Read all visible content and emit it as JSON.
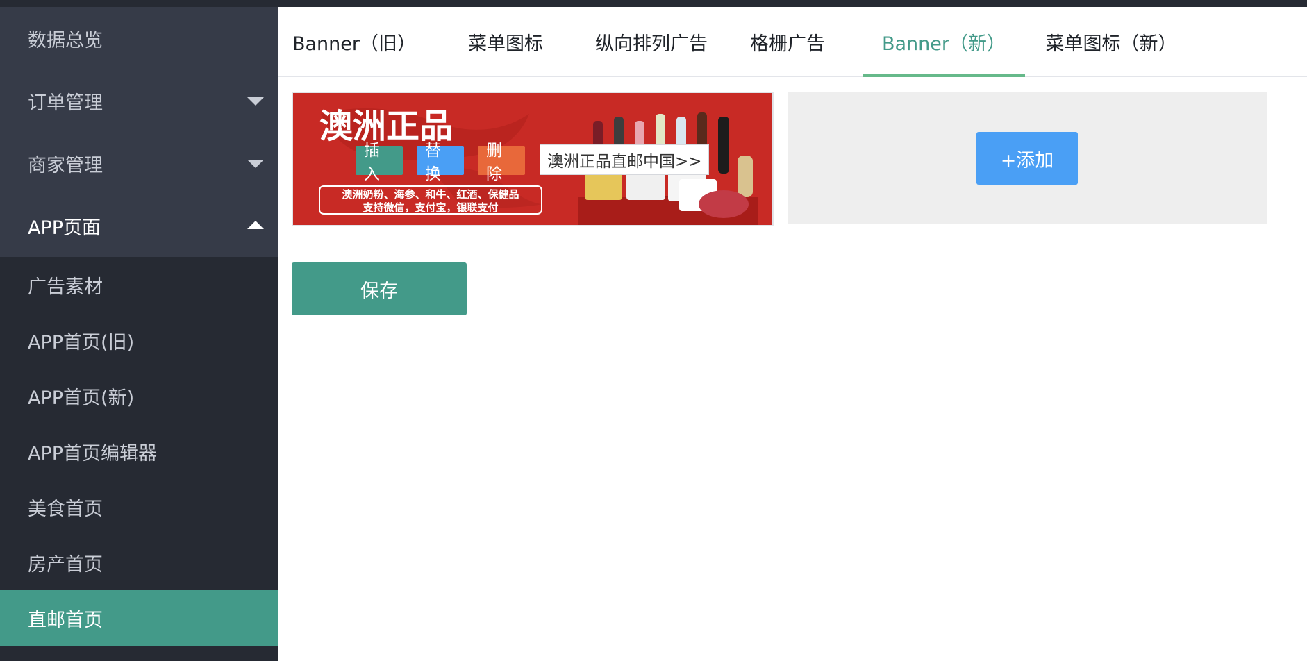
{
  "sidebar": {
    "top_items": [
      {
        "label": "数据总览",
        "arrow": "none"
      },
      {
        "label": "订单管理",
        "arrow": "down"
      },
      {
        "label": "商家管理",
        "arrow": "down"
      },
      {
        "label": "APP页面",
        "arrow": "up"
      }
    ],
    "sub_items": [
      {
        "label": "广告素材"
      },
      {
        "label": "APP首页(旧)"
      },
      {
        "label": "APP首页(新)"
      },
      {
        "label": "APP首页编辑器"
      },
      {
        "label": "美食首页"
      },
      {
        "label": "房产首页"
      },
      {
        "label": "直邮首页",
        "active": true
      }
    ]
  },
  "tabs": [
    {
      "label": "Banner（旧）"
    },
    {
      "label": "菜单图标"
    },
    {
      "label": "纵向排列广告"
    },
    {
      "label": "格栅广告"
    },
    {
      "label": "Banner（新）",
      "active": true
    },
    {
      "label": "菜单图标（新）"
    }
  ],
  "banner": {
    "headline": "澳洲正品",
    "subline_1": "澳洲奶粉、海参、和牛、红酒、保健品",
    "subline_2": "支持微信，支付宝，银联支付",
    "link_text": "澳洲正品直邮中国>>",
    "actions": {
      "insert": "插入",
      "replace": "替换",
      "delete": "删除"
    }
  },
  "add_button": "+添加",
  "save_button": "保存",
  "colors": {
    "sidebar_bg": "#2b2f3a",
    "sidebar_parent_bg": "#363b48",
    "accent_green": "#439a89",
    "tab_underline": "#66b98a",
    "blue": "#4a9ff5",
    "orange": "#e8683a",
    "banner_red": "#c82a25"
  }
}
